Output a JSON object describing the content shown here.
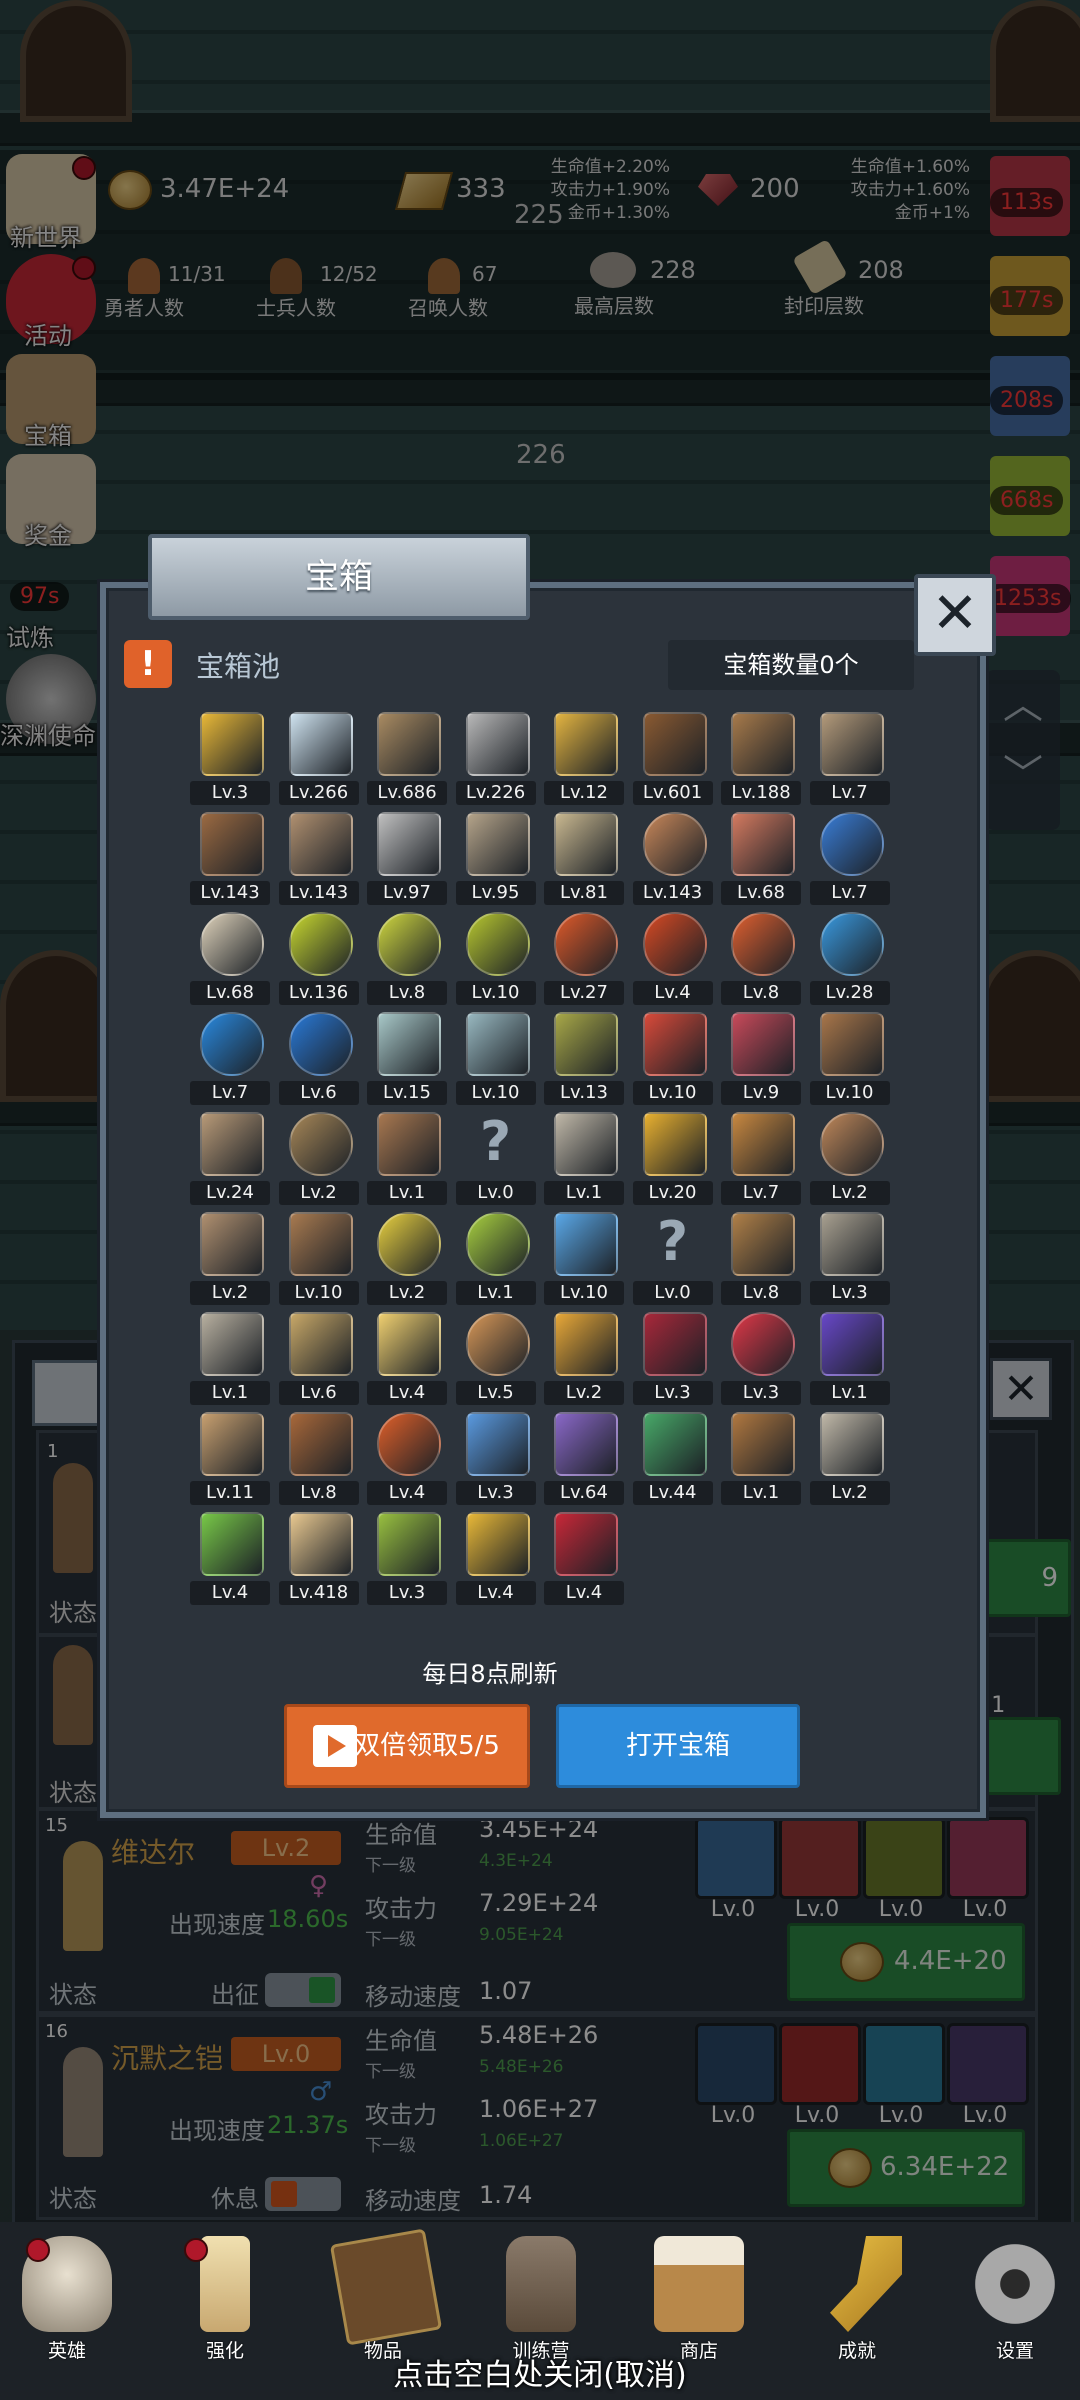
{
  "top_bar": {
    "coins": "3.47E+24",
    "gold_bars": "333",
    "gems": "200",
    "center_level": "225",
    "bonus_left": [
      "生命值+2.20%",
      "攻击力+1.90%",
      "金币+1.30%"
    ],
    "bonus_right": [
      "生命值+1.60%",
      "攻击力+1.60%",
      "金币+1%"
    ],
    "hero_count": "11/31",
    "hero_count_label": "勇者人数",
    "soldier_count": "12/52",
    "soldier_count_label": "士兵人数",
    "summon_count": "67",
    "summon_count_label": "召唤人数",
    "max_floor": "228",
    "max_floor_label": "最高层数",
    "seal_floor": "208",
    "seal_floor_label": "封印层数",
    "floor_marker": "226"
  },
  "left_menu": [
    {
      "label": "新世界",
      "icon": "scroll-map-icon"
    },
    {
      "label": "活动",
      "icon": "heart-icon"
    },
    {
      "label": "宝箱",
      "icon": "chest-icon"
    },
    {
      "label": "奖金",
      "icon": "envelope-icon"
    },
    {
      "label": "试炼",
      "icon": "trial-icon",
      "timer": "97s"
    },
    {
      "label": "深渊使命",
      "icon": "abyss-orb-icon"
    }
  ],
  "right_timers": [
    "113s",
    "177s",
    "208s",
    "668s",
    "1253s"
  ],
  "modal": {
    "tab_title": "宝箱",
    "pool_title": "宝箱池",
    "chest_count": "宝箱数量0个",
    "refresh_note": "每日8点刷新",
    "double_claim": "双倍领取5/5",
    "open_chest": "打开宝箱",
    "items": [
      {
        "level": "Lv.3",
        "icon": "crown-icon",
        "color": "#e8b838"
      },
      {
        "level": "Lv.266",
        "icon": "diamond-icon",
        "color": "#cfe3f0"
      },
      {
        "level": "Lv.686",
        "icon": "sword-icon",
        "color": "#a98b62"
      },
      {
        "level": "Lv.226",
        "icon": "sword-icon",
        "color": "#b8b8b8"
      },
      {
        "level": "Lv.12",
        "icon": "sword-icon",
        "color": "#e3b441"
      },
      {
        "level": "Lv.601",
        "icon": "leather-armor-icon",
        "color": "#8a5a32"
      },
      {
        "level": "Lv.188",
        "icon": "backpack-icon",
        "color": "#a77a4b"
      },
      {
        "level": "Lv.7",
        "icon": "chest-armor-icon",
        "color": "#b39a7a"
      },
      {
        "level": "Lv.143",
        "icon": "helmet-icon",
        "color": "#9b6a42"
      },
      {
        "level": "Lv.143",
        "icon": "dagger-icon",
        "color": "#b09070"
      },
      {
        "level": "Lv.97",
        "icon": "knight-helmet-icon",
        "color": "#c0c0c0"
      },
      {
        "level": "Lv.95",
        "icon": "hammer-icon",
        "color": "#b5a48a"
      },
      {
        "level": "Lv.81",
        "icon": "great-helm-icon",
        "color": "#c9b890"
      },
      {
        "level": "Lv.143",
        "icon": "meat-icon",
        "color": "#c9885a"
      },
      {
        "level": "Lv.68",
        "icon": "steak-icon",
        "color": "#d47a60"
      },
      {
        "level": "Lv.7",
        "icon": "pouch-icon",
        "color": "#3a7ed8"
      },
      {
        "level": "Lv.68",
        "icon": "bread-icon",
        "color": "#e0d4bc"
      },
      {
        "level": "Lv.136",
        "icon": "yellow-potion-icon",
        "color": "#c8d830"
      },
      {
        "level": "Lv.8",
        "icon": "yellow-potion-icon",
        "color": "#d0d840"
      },
      {
        "level": "Lv.10",
        "icon": "yellow-potion-icon",
        "color": "#b8c830"
      },
      {
        "level": "Lv.27",
        "icon": "red-potion-icon",
        "color": "#e05a2a"
      },
      {
        "level": "Lv.4",
        "icon": "red-potion-icon",
        "color": "#d84a24"
      },
      {
        "level": "Lv.8",
        "icon": "red-potion-icon",
        "color": "#e06030"
      },
      {
        "level": "Lv.28",
        "icon": "blue-potion-icon",
        "color": "#3a9ae0"
      },
      {
        "level": "Lv.7",
        "icon": "blue-potion-icon",
        "color": "#2a8ae0"
      },
      {
        "level": "Lv.6",
        "icon": "blue-potion-icon",
        "color": "#2a7ad8"
      },
      {
        "level": "Lv.15",
        "icon": "vial-icon",
        "color": "#a8c8c8"
      },
      {
        "level": "Lv.10",
        "icon": "vial-icon",
        "color": "#98b8c0"
      },
      {
        "level": "Lv.13",
        "icon": "green-bottle-icon",
        "color": "#a8a848"
      },
      {
        "level": "Lv.10",
        "icon": "red-vial-icon",
        "color": "#d84a3a"
      },
      {
        "level": "Lv.9",
        "icon": "winged-boot-icon",
        "color": "#c84a5a"
      },
      {
        "level": "Lv.10",
        "icon": "boot-icon",
        "color": "#a8764a"
      },
      {
        "level": "Lv.24",
        "icon": "shoe-icon",
        "color": "#b89a78"
      },
      {
        "level": "Lv.2",
        "icon": "shield-icon",
        "color": "#a88858"
      },
      {
        "level": "Lv.1",
        "icon": "stick-icon",
        "color": "#a87850"
      },
      {
        "level": "Lv.0",
        "icon": "unknown-icon",
        "color": "#9aa8b4"
      },
      {
        "level": "Lv.1",
        "icon": "short-sword-icon",
        "color": "#c0b8a8"
      },
      {
        "level": "Lv.20",
        "icon": "torch-icon",
        "color": "#e8b030"
      },
      {
        "level": "Lv.7",
        "icon": "fire-staff-icon",
        "color": "#c88840"
      },
      {
        "level": "Lv.2",
        "icon": "mushroom-icon",
        "color": "#c0885a"
      },
      {
        "level": "Lv.2",
        "icon": "pickaxe-icon",
        "color": "#b09070"
      },
      {
        "level": "Lv.10",
        "icon": "wooden-staff-icon",
        "color": "#a87a50"
      },
      {
        "level": "Lv.2",
        "icon": "lemon-icon",
        "color": "#e8d040"
      },
      {
        "level": "Lv.1",
        "icon": "lime-icon",
        "color": "#a8d040"
      },
      {
        "level": "Lv.10",
        "icon": "blue-wand-icon",
        "color": "#5aa8e8"
      },
      {
        "level": "Lv.0",
        "icon": "unknown-icon",
        "color": "#9aa8b4"
      },
      {
        "level": "Lv.8",
        "icon": "backpack-icon",
        "color": "#b08048"
      },
      {
        "level": "Lv.3",
        "icon": "shovel-icon",
        "color": "#a8a090"
      },
      {
        "level": "Lv.1",
        "icon": "axe-icon",
        "color": "#b8b0a0"
      },
      {
        "level": "Lv.6",
        "icon": "broom-icon",
        "color": "#c8a868"
      },
      {
        "level": "Lv.4",
        "icon": "cheese-icon",
        "color": "#f0d070"
      },
      {
        "level": "Lv.5",
        "icon": "pie-icon",
        "color": "#d89858"
      },
      {
        "level": "Lv.2",
        "icon": "jar-icon",
        "color": "#e8a838"
      },
      {
        "level": "Lv.3",
        "icon": "red-crystal-icon",
        "color": "#a8283a"
      },
      {
        "level": "Lv.3",
        "icon": "red-orb-icon",
        "color": "#e03848"
      },
      {
        "level": "Lv.1",
        "icon": "gem-cube-icon",
        "color": "#6848c8"
      },
      {
        "level": "Lv.11",
        "icon": "bow-icon",
        "color": "#c8a070"
      },
      {
        "level": "Lv.8",
        "icon": "quiver-icon",
        "color": "#a8683a"
      },
      {
        "level": "Lv.4",
        "icon": "flame-shield-icon",
        "color": "#e0602a"
      },
      {
        "level": "Lv.3",
        "icon": "blue-spirit-icon",
        "color": "#5a9ae0"
      },
      {
        "level": "Lv.64",
        "icon": "purple-beast-icon",
        "color": "#8a68c8"
      },
      {
        "level": "Lv.44",
        "icon": "emblem-icon",
        "color": "#48a868"
      },
      {
        "level": "Lv.1",
        "icon": "belt-icon",
        "color": "#b07840"
      },
      {
        "level": "Lv.2",
        "icon": "arrow-icon",
        "color": "#c0b8a8"
      },
      {
        "level": "Lv.4",
        "icon": "green-wand-icon",
        "color": "#78c848"
      },
      {
        "level": "Lv.418",
        "icon": "beer-mug-icon",
        "color": "#e8c890"
      },
      {
        "level": "Lv.3",
        "icon": "vine-icon",
        "color": "#98c040"
      },
      {
        "level": "Lv.4",
        "icon": "gold-pickaxe-icon",
        "color": "#e8b838"
      },
      {
        "level": "Lv.4",
        "icon": "spellbook-icon",
        "color": "#c82838"
      }
    ]
  },
  "heroes": [
    {
      "index": "15",
      "name": "维达尔",
      "level": "Lv.2",
      "spawn_label": "出现速度",
      "spawn_speed": "18.60s",
      "status_label": "状态",
      "status_value": "出征",
      "hp_label": "生命值",
      "hp": "3.45E+24",
      "hp_next_label": "下一级",
      "hp_next": "4.3E+24",
      "atk_label": "攻击力",
      "atk": "7.29E+24",
      "atk_next_label": "下一级",
      "atk_next": "9.05E+24",
      "move_label": "移动速度",
      "move": "1.07",
      "skills": [
        "Lv.0",
        "Lv.0",
        "Lv.0",
        "Lv.0"
      ],
      "upgrade_cost": "4.4E+20"
    },
    {
      "index": "16",
      "name": "沉默之铠",
      "level": "Lv.0",
      "spawn_label": "出现速度",
      "spawn_speed": "21.37s",
      "status_label": "状态",
      "status_value": "休息",
      "hp_label": "生命值",
      "hp": "5.48E+26",
      "hp_next_label": "下一级",
      "hp_next": "5.48E+26",
      "atk_label": "攻击力",
      "atk": "1.06E+27",
      "atk_next_label": "下一级",
      "atk_next": "1.06E+27",
      "move_label": "移动速度",
      "move": "1.74",
      "skills": [
        "Lv.0",
        "Lv.0",
        "Lv.0",
        "Lv.0"
      ],
      "upgrade_cost": "6.34E+22"
    }
  ],
  "partial_cards": {
    "card1_index": "1",
    "status_label": "状态",
    "cost_partial": "9",
    "skill_partial": "v.1"
  },
  "bottom_nav": [
    {
      "label": "英雄",
      "icon": "skull-icon"
    },
    {
      "label": "强化",
      "icon": "candle-icon"
    },
    {
      "label": "物品",
      "icon": "book-icon"
    },
    {
      "label": "训练营",
      "icon": "lantern-icon"
    },
    {
      "label": "商店",
      "icon": "beer-mug-icon"
    },
    {
      "label": "成就",
      "icon": "key-icon"
    },
    {
      "label": "设置",
      "icon": "gear-icon"
    }
  ],
  "bottom_hint": "点击空白处关闭(取消)"
}
